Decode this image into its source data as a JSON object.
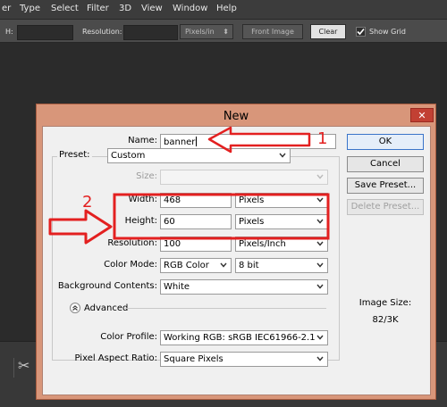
{
  "menu": [
    "er",
    "Type",
    "Select",
    "Filter",
    "3D",
    "View",
    "Window",
    "Help"
  ],
  "options_bar": {
    "h_label": "H:",
    "resolution_label": "Resolution:",
    "units_value": "Pixels/in",
    "front_image": "Front Image",
    "clear": "Clear",
    "show_grid": "Show Grid"
  },
  "dialog": {
    "title": "New",
    "close": "✕",
    "name_label": "Name:",
    "name_value": "banner",
    "preset_label": "Preset:",
    "preset_value": "Custom",
    "size_label": "Size:",
    "width_label": "Width:",
    "width_value": "468",
    "width_unit": "Pixels",
    "height_label": "Height:",
    "height_value": "60",
    "height_unit": "Pixels",
    "resolution_label": "Resolution:",
    "resolution_value": "100",
    "resolution_unit": "Pixels/Inch",
    "color_mode_label": "Color Mode:",
    "color_mode_value": "RGB Color",
    "bit_depth": "8 bit",
    "bg_contents_label": "Background Contents:",
    "bg_contents_value": "White",
    "advanced_label": "Advanced",
    "color_profile_label": "Color Profile:",
    "color_profile_value": "Working RGB:  sRGB IEC61966-2.1",
    "pixel_aspect_label": "Pixel Aspect Ratio:",
    "pixel_aspect_value": "Square Pixels",
    "buttons": {
      "ok": "OK",
      "cancel": "Cancel",
      "save_preset": "Save Preset...",
      "delete_preset": "Delete Preset..."
    },
    "image_size_label": "Image Size:",
    "image_size_value": "82/3K"
  },
  "annotations": {
    "step1": "1",
    "step2": "2",
    "color": "#e32020"
  }
}
